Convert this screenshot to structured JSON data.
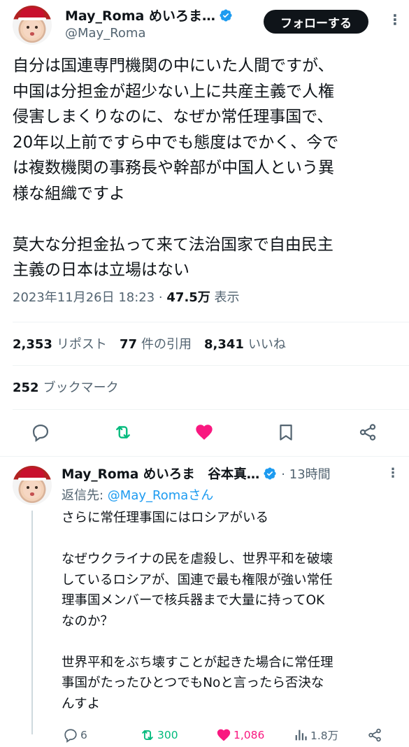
{
  "main_tweet": {
    "display_name": "May_Roma めいろま…",
    "handle": "@May_Roma",
    "follow_label": "フォローする",
    "text": "自分は国連専門機関の中にいた人間ですが、\n中国は分担金が超少ない上に共産主義で人権\n侵害しまくりなのに、なぜか常任理事国で、\n20年以上前ですら中でも態度はでかく、今で\nは複数機関の事務長や幹部が中国人という異\n様な組織ですよ\n\n莫大な分担金払って来て法治国家で自由民主\n主義の日本は立場はない",
    "timestamp": "2023年11月26日 18:23 · ",
    "views_count": "47.5万",
    "views_label": " 表示",
    "stats": {
      "reposts_count": "2,353",
      "reposts_label": "リポスト",
      "quotes_count": "77",
      "quotes_label": "件の引用",
      "likes_count": "8,341",
      "likes_label": "いいね",
      "bookmarks_count": "252",
      "bookmarks_label": "ブックマーク"
    },
    "actions": [
      "reply-icon",
      "repost-icon",
      "like-icon",
      "bookmark-icon",
      "share-icon"
    ]
  },
  "reply_tweet": {
    "display_name": "May_Roma めいろま　谷本真…",
    "time_ago": "· 13時間",
    "reply_to_label": "返信先: ",
    "reply_to_handle": "@May_Romaさん",
    "text": "さらに常任理事国にはロシアがいる\n\nなぜウクライナの民を虐殺し、世界平和を破壊\nしているロシアが、国連で最も権限が強い常任\n理事国メンバーで核兵器まで大量に持ってOK\nなのか？\n\n世界平和をぶち壊すことが起きた場合に常任理\n事国がたったひとつでもNoと言ったら否決な\nんすよ",
    "replies": "6",
    "reposts": "300",
    "likes": "1,086",
    "views": "1.8万"
  },
  "colors": {
    "text_primary": "#0f1419",
    "text_secondary": "#536471",
    "link": "#1d9bf0",
    "verified": "#1d9bf0",
    "repost_green": "#00ba7c",
    "like_pink": "#f91880",
    "follow_bg": "#0f1419"
  }
}
